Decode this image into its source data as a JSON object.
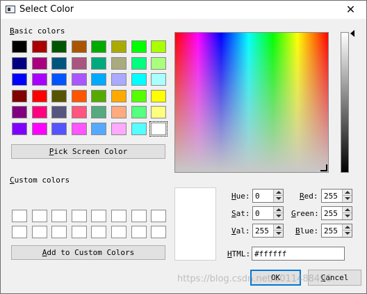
{
  "window": {
    "title": "Select Color",
    "close_glyph": "✕"
  },
  "basic": {
    "label_prefix": "B",
    "label_rest": "asic colors",
    "columns": [
      [
        "#000000",
        "#000080",
        "#0000ff",
        "#800000",
        "#800080",
        "#8000ff"
      ],
      [
        "#aa0000",
        "#aa007f",
        "#aa00ff",
        "#ff0000",
        "#ff007f",
        "#ff00ff"
      ],
      [
        "#005500",
        "#00557f",
        "#0055ff",
        "#555500",
        "#55557f",
        "#5555ff"
      ],
      [
        "#aa5500",
        "#aa557f",
        "#aa55ff",
        "#ff5500",
        "#ff557f",
        "#ff55ff"
      ],
      [
        "#00aa00",
        "#00aa7f",
        "#00aaff",
        "#55aa00",
        "#55aa7f",
        "#55aaff"
      ],
      [
        "#aaaa00",
        "#aaaa7f",
        "#aaaaff",
        "#ffaa00",
        "#ffaa7f",
        "#ffaaff"
      ],
      [
        "#00ff00",
        "#00ff7f",
        "#00ffff",
        "#55ff00",
        "#55ff7f",
        "#55ffff"
      ],
      [
        "#aaff00",
        "#aaff7f",
        "#aaffff",
        "#ffff00",
        "#ffff7f",
        "#ffffff"
      ]
    ],
    "selected": "#ffffff"
  },
  "pick_button": {
    "prefix": "P",
    "rest": "ick Screen Color"
  },
  "custom": {
    "label_prefix": "C",
    "label_rest": "ustom colors",
    "count": 16
  },
  "add_button": {
    "prefix": "A",
    "rest": "dd to Custom Colors"
  },
  "fields": {
    "hue": {
      "prefix": "H",
      "rest": "ue:",
      "value": "0"
    },
    "sat": {
      "prefix": "S",
      "rest": "at:",
      "value": "0"
    },
    "val": {
      "prefix": "V",
      "rest": "al:",
      "value": "255"
    },
    "red": {
      "prefix": "R",
      "rest": "ed:",
      "value": "255"
    },
    "green": {
      "prefix": "G",
      "rest": "reen:",
      "value": "255"
    },
    "blue": {
      "prefix": "B",
      "rest": "lue:",
      "value": "255"
    },
    "html": {
      "prefix": "H",
      "rest": "TML:",
      "value": "#ffffff"
    }
  },
  "ok_button": {
    "label": "OK"
  },
  "cancel_button": {
    "prefix": "C",
    "rest": "ancel"
  },
  "watermark": "https://blog.csdn.net/u011488496"
}
